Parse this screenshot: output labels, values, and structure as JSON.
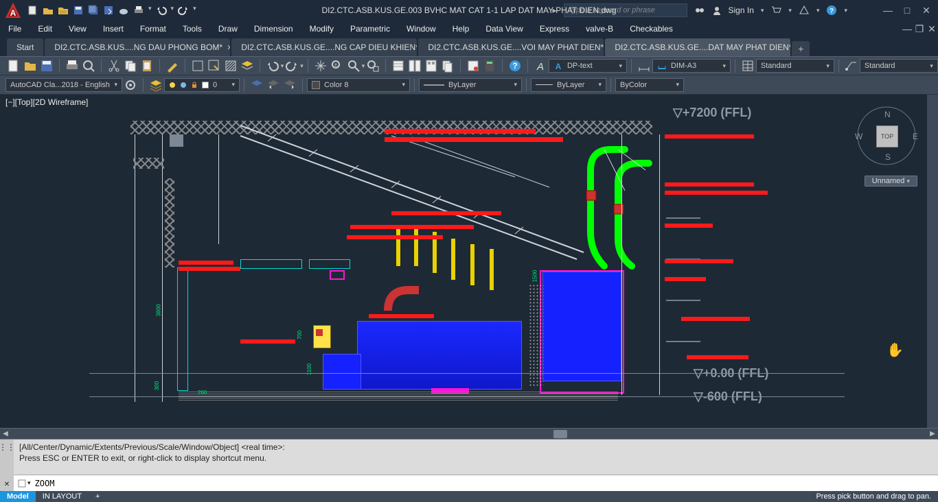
{
  "title_bar": {
    "file_title": "DI2.CTC.ASB.KUS.GE.003 BVHC MAT CAT 1-1 LAP DAT MAY PHAT DIEN.dwg",
    "search_placeholder": "Type a keyword or phrase",
    "sign_in": "Sign In"
  },
  "menu": {
    "items": [
      "File",
      "Edit",
      "View",
      "Insert",
      "Format",
      "Tools",
      "Draw",
      "Dimension",
      "Modify",
      "Parametric",
      "Window",
      "Help",
      "Data View",
      "Express",
      "valve-B",
      "Checkables"
    ]
  },
  "file_tabs": {
    "start": "Start",
    "tabs": [
      {
        "label": "DI2.CTC.ASB.KUS....NG DAU PHONG BOM*",
        "active": false
      },
      {
        "label": "DI2.CTC.ASB.KUS.GE....NG CAP DIEU KHIEN*",
        "active": false
      },
      {
        "label": "DI2.CTC.ASB.KUS.GE....VOI MAY PHAT DIEN*",
        "active": false
      },
      {
        "label": "DI2.CTC.ASB.KUS.GE....DAT MAY PHAT DIEN*",
        "active": true
      }
    ]
  },
  "ribbon": {
    "text_style": "DP-text",
    "dim_style": "DIM-A3",
    "table_style": "Standard",
    "mleader_style": "Standard",
    "workspace": "AutoCAD Cla...2018 - English",
    "layer_color_swatch": "0",
    "current_color": "Color 8",
    "lineweight": "ByLayer",
    "linetype": "ByLayer",
    "plot_style": "ByColor"
  },
  "viewport": {
    "label": "[−][Top][2D Wireframe]",
    "viewcube_face": "TOP",
    "unnamed": "Unnamed"
  },
  "drawing_text": {
    "ffl_top": "▽+7200 (FFL)",
    "ffl_mid": "▽+0.00 (FFL)",
    "ffl_bot": "▽-600 (FFL)",
    "dim_3800": "3800",
    "dim_300": "300",
    "dim_260": "260",
    "dim_700": "700",
    "dim_1100": "1100",
    "dim_1500": "1500"
  },
  "command_window": {
    "history": "[All/Center/Dynamic/Extents/Previous/Scale/Window/Object] <real time>:\nPress ESC or ENTER to exit, or right-click to display shortcut menu.",
    "prompt_indicator": "▸_",
    "input_value": "ZOOM"
  },
  "status_bar": {
    "model": "Model",
    "layout": "IN LAYOUT",
    "message": "Press pick button and drag to pan."
  }
}
